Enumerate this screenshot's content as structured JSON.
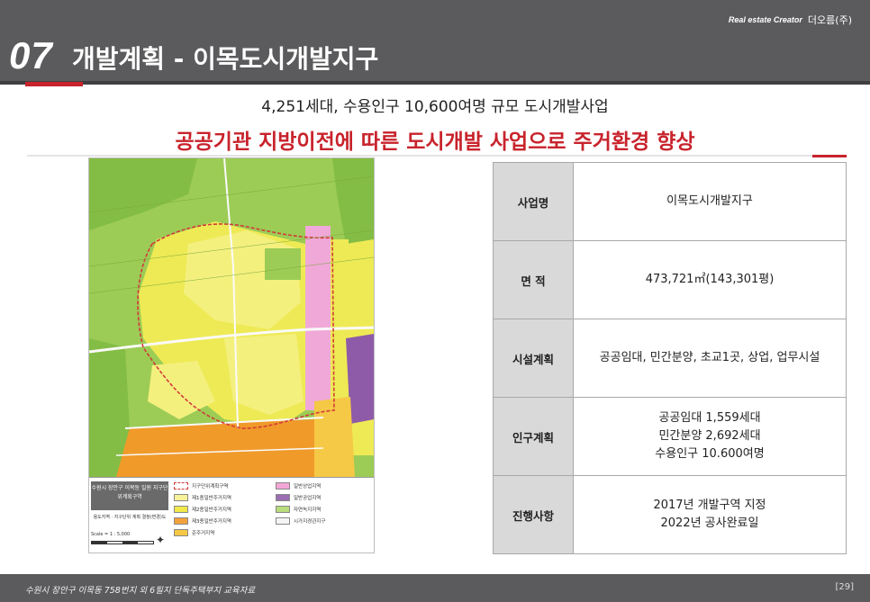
{
  "header": {
    "section_number": "07",
    "title": "개발계획 - 이목도시개발지구",
    "logo_tagline": "Real estate Creator",
    "logo_mark": "더오름(주)"
  },
  "subtitle": "4,251세대, 수용인구 10,600여명 규모 도시개발사업",
  "headline": "공공기관 지방이전에 따른 도시개발 사업으로 주거환경 향상",
  "map": {
    "legend_title": "수원시 장안구 이목동 일원 지구단위계획구역",
    "legend_note": "용도지역 · 지구단위 계획 결정(변경)도",
    "scale_label": "Scale = 1 : 5,000",
    "legend_items": [
      {
        "label": "지구단위계획구역",
        "color": "#ffffff"
      },
      {
        "label": "일반상업지역",
        "color": "#f4a6d6"
      },
      {
        "label": "제1종일반주거지역",
        "color": "#f8f29a"
      },
      {
        "label": "일반공업지역",
        "color": "#9b6fb2"
      },
      {
        "label": "제2종일반주거지역",
        "color": "#f1e84a"
      },
      {
        "label": "자연녹지지역",
        "color": "#b9dc7c"
      },
      {
        "label": "제3종일반주거지역",
        "color": "#f2a23a"
      },
      {
        "label": "시가지경관지구",
        "color": "#f5f5f5"
      },
      {
        "label": "준주거지역",
        "color": "#f5c945"
      }
    ],
    "colors": {
      "green": "#9ccc55",
      "yellow": "#eeea55",
      "pale_yellow": "#f4f07e",
      "orange": "#f09a2a",
      "pink": "#f0a8d8",
      "purple": "#8e5ba8",
      "boundary": "#d23a3a"
    }
  },
  "table": {
    "rows": [
      {
        "label": "사업명",
        "lines": [
          "이목도시개발지구"
        ]
      },
      {
        "label": "면 적",
        "lines": [
          "473,721㎡(143,301평)"
        ]
      },
      {
        "label": "시설계획",
        "lines": [
          "공공임대, 민간분양, 초교1곳, 상업, 업무시설"
        ]
      },
      {
        "label": "인구계획",
        "lines": [
          "공공임대 1,559세대",
          "민간분양 2,692세대",
          "수용인구 10.600여명"
        ]
      },
      {
        "label": "진행사항",
        "lines": [
          "2017년 개발구역 지정",
          "2022년 공사완료일"
        ]
      }
    ]
  },
  "footer": {
    "text": "수원시 장안구 이목동 758번지 외 6필지 단독주택부지 교육자료",
    "page": "[29]"
  },
  "colors": {
    "header_bg": "#5b5b5d",
    "accent_red": "#c8232c",
    "table_header_bg": "#d9d9d9"
  }
}
